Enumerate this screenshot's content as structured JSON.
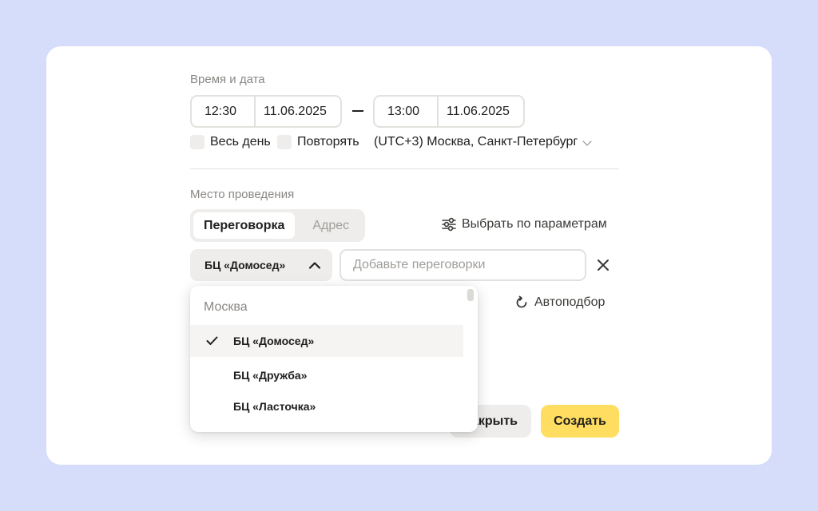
{
  "time_date": {
    "section_label": "Время и дата",
    "start_time": "12:30",
    "start_date": "11.06.2025",
    "end_time": "13:00",
    "end_date": "11.06.2025",
    "all_day_label": "Весь день",
    "repeat_label": "Повторять",
    "timezone": "(UTC+3) Москва, Санкт-Петербург"
  },
  "location": {
    "section_label": "Место проведения",
    "tabs": [
      {
        "label": "Переговорка",
        "active": true
      },
      {
        "label": "Адрес",
        "active": false
      }
    ],
    "filter_button": "Выбрать по параметрам",
    "office_select": "БЦ «Домосед»",
    "rooms_input": {
      "value": "",
      "placeholder": "Добавьте переговорки"
    },
    "autoselect_button": "Автоподбор"
  },
  "dropdown": {
    "group": "Москва",
    "items": [
      {
        "label": "БЦ «Домосед»",
        "selected": true
      },
      {
        "label": "БЦ «Дружба»",
        "selected": false
      },
      {
        "label": "БЦ «Ласточка»",
        "selected": false
      }
    ]
  },
  "actions": {
    "close_label": "Закрыть",
    "create_label": "Создать"
  },
  "colors": {
    "background": "#d6ddfb",
    "primary": "#ffdd60",
    "secondary": "#eeedeb"
  }
}
